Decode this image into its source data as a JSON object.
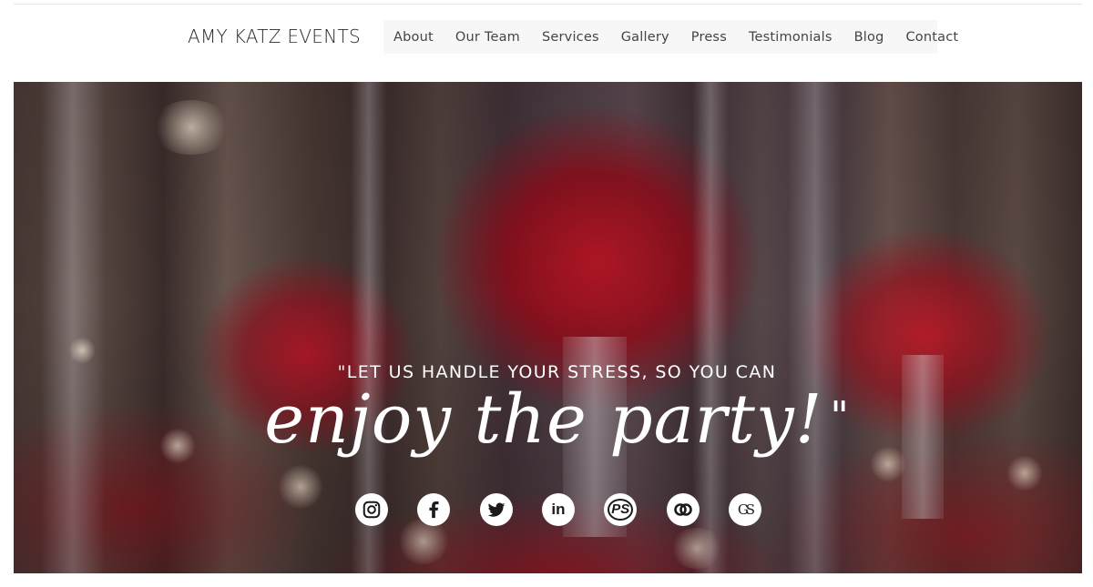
{
  "header": {
    "brand": "AMY KATZ EVENTS",
    "nav": [
      {
        "label": "About"
      },
      {
        "label": "Our Team"
      },
      {
        "label": "Services"
      },
      {
        "label": "Gallery"
      },
      {
        "label": "Press"
      },
      {
        "label": "Testimonials"
      },
      {
        "label": "Blog"
      },
      {
        "label": "Contact"
      }
    ]
  },
  "hero": {
    "quote_line1": "\"LET US HANDLE YOUR STRESS, SO YOU CAN",
    "quote_line2": "enjoy the party!",
    "quote_close": "\"",
    "social": [
      {
        "icon": "instagram-icon"
      },
      {
        "icon": "facebook-icon"
      },
      {
        "icon": "twitter-icon"
      },
      {
        "icon": "linkedin-icon",
        "text": "in"
      },
      {
        "icon": "pinterest-ps-icon",
        "text": "PS"
      },
      {
        "icon": "link-icon"
      },
      {
        "icon": "monogram-gs-icon",
        "text": "GS"
      }
    ]
  },
  "colors": {
    "brand_text": "#2a2a2a",
    "nav_text": "#444444",
    "nav_bg": "#f7f7f7",
    "hero_text": "#ffffff",
    "accent_red": "#b5142a"
  }
}
